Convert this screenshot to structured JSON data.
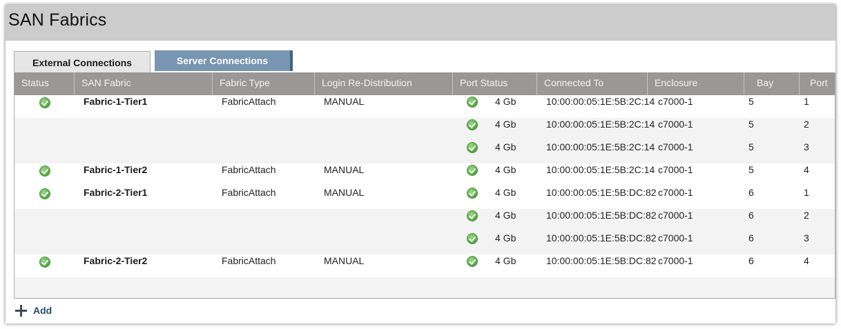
{
  "page": {
    "title": "SAN Fabrics"
  },
  "tabs": [
    {
      "label": "External Connections",
      "active": true
    },
    {
      "label": "Server Connections",
      "active": false
    }
  ],
  "table": {
    "columns": [
      "Status",
      "SAN Fabric",
      "Fabric Type",
      "Login Re-Distribution",
      "Port Status",
      "Connected To",
      "Enclosure",
      "Bay",
      "Port"
    ],
    "rows": [
      {
        "status": "ok",
        "san_fabric": "Fabric-1-Tier1",
        "fabric_type": "FabricAttach",
        "login": "MANUAL",
        "port_status": "4 Gb",
        "connected_to": "10:00:00:05:1E:5B:2C:14",
        "enclosure": "c7000-1",
        "bay": "5",
        "port": "1"
      },
      {
        "status": "",
        "san_fabric": "",
        "fabric_type": "",
        "login": "",
        "port_status": "4 Gb",
        "connected_to": "10:00:00:05:1E:5B:2C:14",
        "enclosure": "c7000-1",
        "bay": "5",
        "port": "2"
      },
      {
        "status": "",
        "san_fabric": "",
        "fabric_type": "",
        "login": "",
        "port_status": "4 Gb",
        "connected_to": "10:00:00:05:1E:5B:2C:14",
        "enclosure": "c7000-1",
        "bay": "5",
        "port": "3"
      },
      {
        "status": "ok",
        "san_fabric": "Fabric-1-Tier2",
        "fabric_type": "FabricAttach",
        "login": "MANUAL",
        "port_status": "4 Gb",
        "connected_to": "10:00:00:05:1E:5B:2C:14",
        "enclosure": "c7000-1",
        "bay": "5",
        "port": "4"
      },
      {
        "status": "ok",
        "san_fabric": "Fabric-2-Tier1",
        "fabric_type": "FabricAttach",
        "login": "MANUAL",
        "port_status": "4 Gb",
        "connected_to": "10:00:00:05:1E:5B:DC:82",
        "enclosure": "c7000-1",
        "bay": "6",
        "port": "1"
      },
      {
        "status": "",
        "san_fabric": "",
        "fabric_type": "",
        "login": "",
        "port_status": "4 Gb",
        "connected_to": "10:00:00:05:1E:5B:DC:82",
        "enclosure": "c7000-1",
        "bay": "6",
        "port": "2"
      },
      {
        "status": "",
        "san_fabric": "",
        "fabric_type": "",
        "login": "",
        "port_status": "4 Gb",
        "connected_to": "10:00:00:05:1E:5B:DC:82",
        "enclosure": "c7000-1",
        "bay": "6",
        "port": "3"
      },
      {
        "status": "ok",
        "san_fabric": "Fabric-2-Tier2",
        "fabric_type": "FabricAttach",
        "login": "MANUAL",
        "port_status": "4 Gb",
        "connected_to": "10:00:00:05:1E:5B:DC:82",
        "enclosure": "c7000-1",
        "bay": "6",
        "port": "4"
      }
    ]
  },
  "actions": {
    "add_label": "Add"
  },
  "icons": {
    "status_ok": "check-circle-icon",
    "add": "plus-icon"
  },
  "colors": {
    "title_bar": "#cccccc",
    "header": "#9b9795",
    "tab_inactive": "#7895b2",
    "ok_green": "#5dae4a",
    "row_alt": "#f3f3f3"
  }
}
